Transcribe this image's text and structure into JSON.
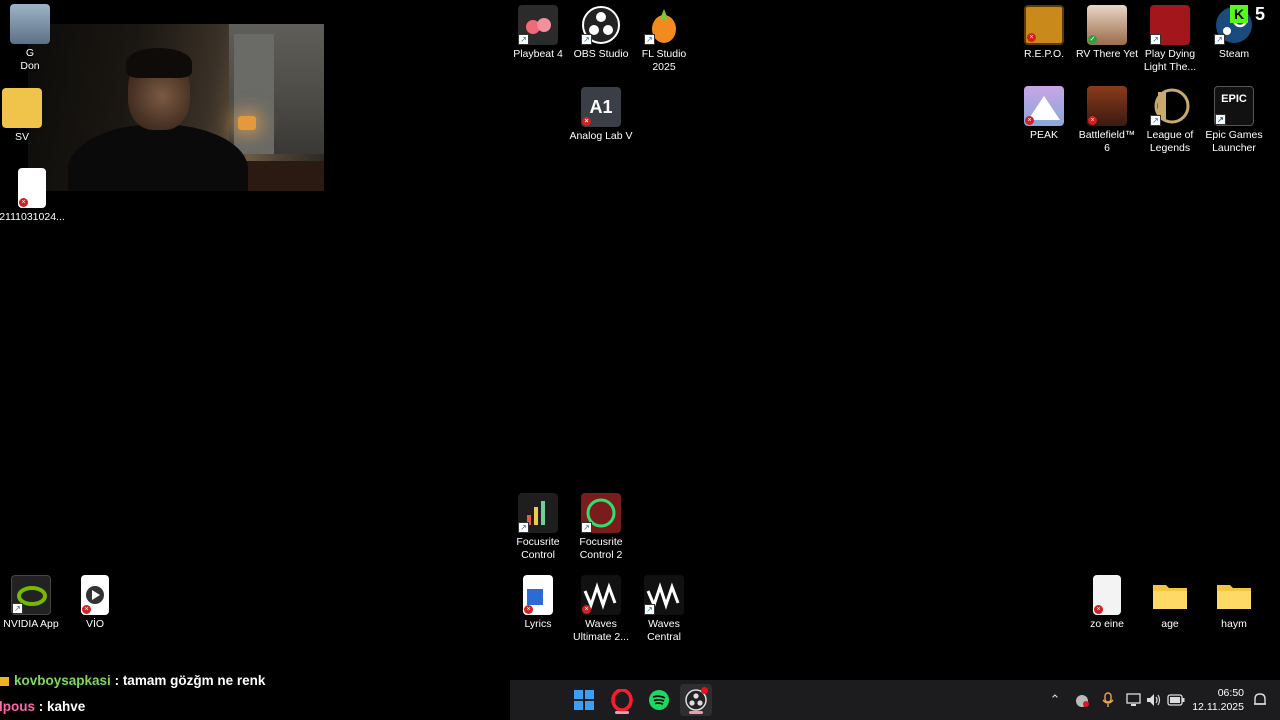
{
  "desktop": {
    "icons": [
      {
        "name": "recycle-bin",
        "label": "G\nDon",
        "partial": true
      },
      {
        "name": "sv-folder",
        "label": "SV",
        "partial": true
      },
      {
        "name": "word-doc-2111",
        "label": "2111031024..."
      },
      {
        "name": "playbeat",
        "label": "Playbeat 4"
      },
      {
        "name": "obs-studio",
        "label": "OBS Studio"
      },
      {
        "name": "fl-studio",
        "label": "FL Studio\n2025"
      },
      {
        "name": "analog-lab",
        "label": "Analog Lab V"
      },
      {
        "name": "repo",
        "label": "R.E.P.O."
      },
      {
        "name": "rv-there-yet",
        "label": "RV There Yet"
      },
      {
        "name": "play-dying-light",
        "label": "Play Dying\nLight The..."
      },
      {
        "name": "steam",
        "label": "Steam"
      },
      {
        "name": "peak",
        "label": "PEAK"
      },
      {
        "name": "battlefield",
        "label": "Battlefield™\n6"
      },
      {
        "name": "league-of-legends",
        "label": "League of\nLegends"
      },
      {
        "name": "epic-games",
        "label": "Epic Games\nLauncher"
      },
      {
        "name": "focusrite-control",
        "label": "Focusrite\nControl"
      },
      {
        "name": "focusrite-control-2",
        "label": "Focusrite\nControl 2"
      },
      {
        "name": "nvidia-app",
        "label": "NVIDIA App"
      },
      {
        "name": "vio",
        "label": "VİO"
      },
      {
        "name": "lyrics",
        "label": "Lyrics"
      },
      {
        "name": "waves-ultimate",
        "label": "Waves\nUltimate 2..."
      },
      {
        "name": "waves-central",
        "label": "Waves\nCentral"
      },
      {
        "name": "zo-eine",
        "label": "zo eine"
      },
      {
        "name": "age-folder",
        "label": "age"
      },
      {
        "name": "haym-folder",
        "label": "haym"
      }
    ],
    "overlay_counter": "5"
  },
  "chat": {
    "messages": [
      {
        "user": "kovboysapkasi",
        "sep": " : ",
        "text": "tamam gözğm ne renk"
      },
      {
        "user": "lpous",
        "sep": " : ",
        "text": "kahve"
      }
    ]
  },
  "taskbar": {
    "apps": [
      "windows-start-icon",
      "opera-icon",
      "spotify-icon",
      "obs-icon"
    ],
    "clock": {
      "time": "06:50",
      "date": "12.11.2025"
    }
  },
  "colors": {
    "accent_chat_user1": "#7ed957",
    "accent_chat_user2": "#ff66aa",
    "taskbar": "#1c1c1e"
  }
}
